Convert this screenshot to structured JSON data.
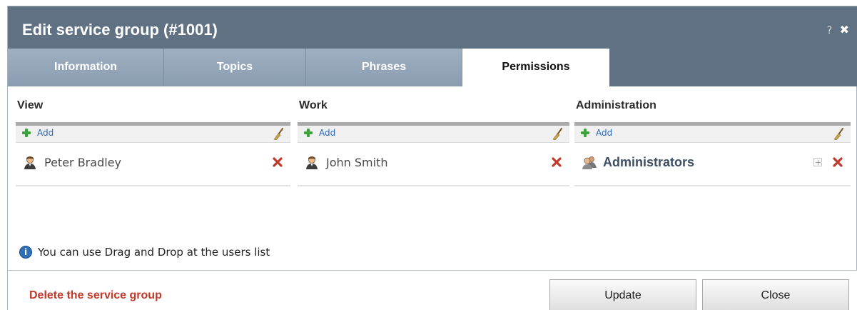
{
  "dialog": {
    "title": "Edit service group (#1001)",
    "help_label": "?",
    "close_glyph": "✖"
  },
  "tabs": [
    {
      "label": "Information",
      "active": false
    },
    {
      "label": "Topics",
      "active": false
    },
    {
      "label": "Phrases",
      "active": false
    },
    {
      "label": "Permissions",
      "active": true
    }
  ],
  "permissions": {
    "view": {
      "header": "View",
      "add_label": "Add",
      "entries": [
        {
          "name": "Peter Bradley",
          "type": "user"
        }
      ]
    },
    "work": {
      "header": "Work",
      "add_label": "Add",
      "entries": [
        {
          "name": "John Smith",
          "type": "user"
        }
      ]
    },
    "administration": {
      "header": "Administration",
      "add_label": "Add",
      "entries": [
        {
          "name": "Administrators",
          "type": "group"
        }
      ]
    }
  },
  "hint": {
    "icon": "info-icon",
    "text": "You can use Drag and Drop at the users list"
  },
  "footer": {
    "delete_label": "Delete the service group",
    "update_label": "Update",
    "close_label": "Close"
  },
  "colors": {
    "titlebar": "#5f7183",
    "tab_inactive": "#94a6b9",
    "delete_link": "#c0392b",
    "remove_icon": "#c0392b",
    "add_icon": "#3aa33a",
    "link": "#2c68b5"
  }
}
